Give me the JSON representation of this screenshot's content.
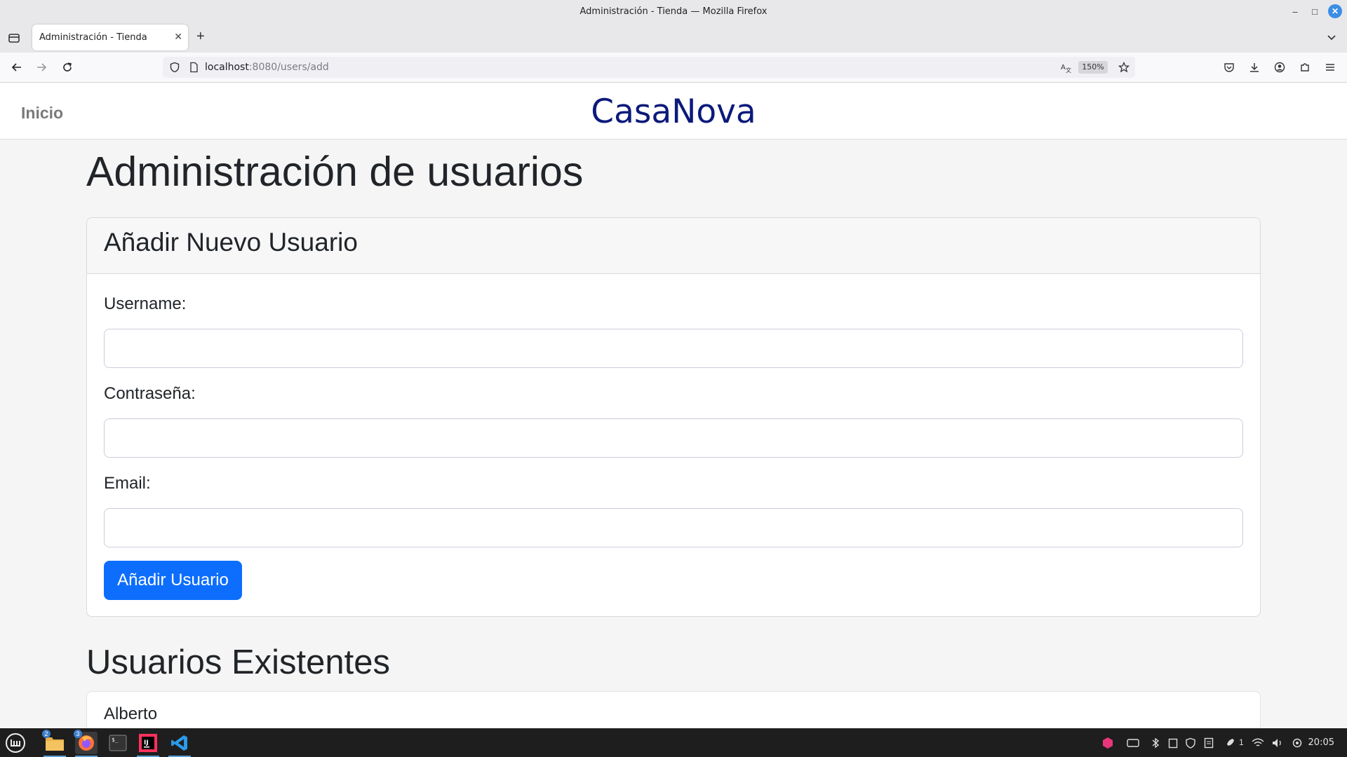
{
  "window": {
    "title": "Administración - Tienda — Mozilla Firefox"
  },
  "browser": {
    "tab_title": "Administración - Tienda",
    "url_host": "localhost",
    "url_rest": ":8080/users/add",
    "zoom": "150%"
  },
  "site": {
    "home_link": "Inicio",
    "brand": "CasaNova"
  },
  "page": {
    "title": "Administración de usuarios",
    "form": {
      "heading": "Añadir Nuevo Usuario",
      "username_label": "Username:",
      "username_value": "",
      "password_label": "Contraseña:",
      "password_value": "",
      "email_label": "Email:",
      "email_value": "",
      "submit_label": "Añadir Usuario"
    },
    "existing_heading": "Usuarios Existentes",
    "users": [
      "Alberto"
    ]
  },
  "colors": {
    "brand": "#0b1a7a",
    "primary_button": "#0d6efd",
    "page_background": "#f5f5f5"
  },
  "taskbar": {
    "badges": {
      "files": "2",
      "firefox": "3"
    },
    "workspace_count": "1",
    "clock": "20:05"
  }
}
